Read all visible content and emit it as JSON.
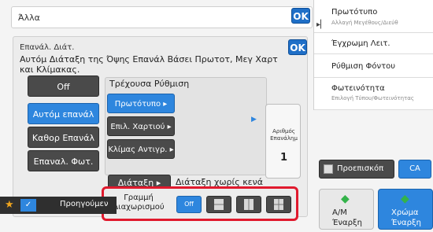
{
  "topbar": {
    "title": "Άλλα",
    "ok_label": "OK"
  },
  "dialog": {
    "title": "Επανάλ. Διάτ.",
    "ok_label": "OK",
    "description": "Αυτόμ Διάταξη της Όψης Επανάλ Βάσει Πρωτοτ, Μεγ Χαρτ και Κλίμακας.",
    "left_buttons": [
      {
        "label": "Off",
        "selected": false
      },
      {
        "label": "Αυτόμ επανάλ",
        "selected": true
      },
      {
        "label": "Καθορ Επανάλ",
        "selected": false
      },
      {
        "label": "Επαναλ. Φωτ.",
        "selected": false
      }
    ],
    "current_setting_label": "Τρέχουσα Ρύθμιση",
    "mid_buttons": [
      {
        "label": "Πρωτότυπο",
        "selected": true
      },
      {
        "label": "Επιλ. Χαρτιού",
        "selected": false
      },
      {
        "label": "Κλίμας Αντιγρ.",
        "selected": false
      }
    ],
    "repeat_count": {
      "label": "Αριθμός Επανάλημ",
      "value": "1"
    },
    "arrangement": {
      "button_label": "Διάταξη",
      "value": "Διάταξη χωρίς κενά"
    },
    "separation_line": {
      "label": "Γραμμή Διαχωρισμού",
      "options": [
        {
          "label": "Off",
          "selected": true,
          "icon": "off"
        },
        {
          "label": "",
          "selected": false,
          "icon": "line-style-1-icon"
        },
        {
          "label": "",
          "selected": false,
          "icon": "line-style-2-icon"
        },
        {
          "label": "",
          "selected": false,
          "icon": "line-style-3-icon"
        }
      ]
    }
  },
  "right_panel": {
    "items": [
      {
        "title": "Πρωτότυπο",
        "subtitle": "Αλλαγή Μεγέθους/Διεύθ"
      },
      {
        "title": "Έγχρωμη Λειτ.",
        "subtitle": ""
      },
      {
        "title": "Ρύθμιση Φόντου",
        "subtitle": ""
      },
      {
        "title": "Φωτεινότητα",
        "subtitle": "Επιλογή Τύπου/Φωτεινότητας"
      }
    ],
    "preview_label": "Προεπισκόπ",
    "ca_label": "CA",
    "start_bw": {
      "line1": "Α/Μ",
      "line2": "Έναρξη"
    },
    "start_color": {
      "line1": "Χρώμα",
      "line2": "Έναρξη"
    }
  },
  "bottom": {
    "prev_label": "Προηγούμεν"
  },
  "colors": {
    "accent": "#2e86de",
    "highlight": "#e0192d",
    "dark_button": "#4a4a4a"
  }
}
